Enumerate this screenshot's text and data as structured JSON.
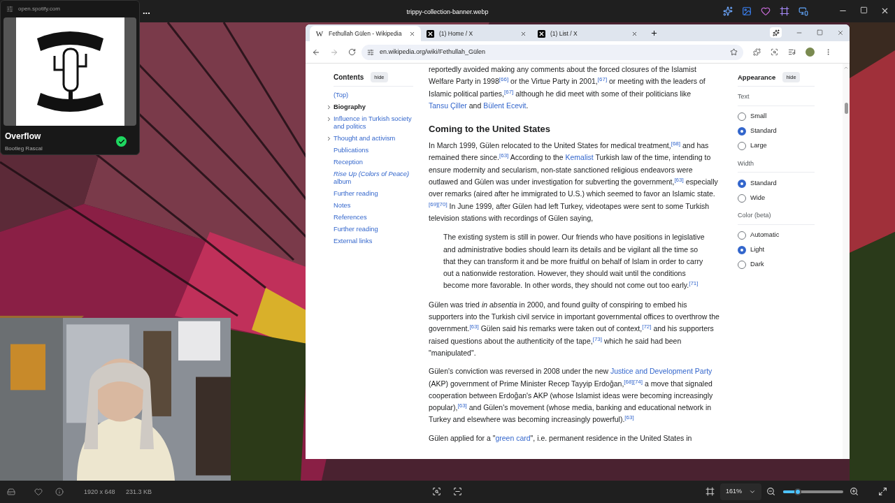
{
  "viewer": {
    "title": "trippy-collection-banner.webp",
    "more": "...",
    "dimensions": "1920 x 648",
    "file_size": "231.3 KB",
    "zoom": "161%",
    "zoom_slider": {
      "level": 0.24
    }
  },
  "mini_player": {
    "site": "open.spotify.com",
    "track": "Overflow",
    "artist": "Bootleg Rascal",
    "saved": true
  },
  "browser": {
    "tabs": [
      {
        "title": "Fethullah Gülen - Wikipedia",
        "favicon": "W",
        "kind": "wiki",
        "selected": true
      },
      {
        "title": "(1) Home / X",
        "kind": "x",
        "selected": false
      },
      {
        "title": "(1) List / X",
        "kind": "x",
        "selected": false
      }
    ],
    "url": "en.wikipedia.org/wiki/Fethullah_Gülen"
  },
  "toc": {
    "title": "Contents",
    "hide": "hide",
    "items": [
      {
        "label": "(Top)",
        "expandable": false,
        "current": false
      },
      {
        "label": "Biography",
        "expandable": true,
        "current": true
      },
      {
        "label": "Influence in Turkish society and politics",
        "expandable": true,
        "current": false
      },
      {
        "label": "Thought and activism",
        "expandable": true,
        "current": false
      },
      {
        "label": "Publications",
        "expandable": false,
        "current": false
      },
      {
        "label": "Reception",
        "expandable": false,
        "current": false
      },
      {
        "label": "*Rise Up (Colors of Peace)* album",
        "expandable": false,
        "current": false
      },
      {
        "label": "Further reading",
        "expandable": false,
        "current": false
      },
      {
        "label": "Notes",
        "expandable": false,
        "current": false
      },
      {
        "label": "References",
        "expandable": false,
        "current": false
      },
      {
        "label": "Further reading",
        "expandable": false,
        "current": false
      },
      {
        "label": "External links",
        "expandable": false,
        "current": false
      }
    ]
  },
  "article": {
    "blocks": [
      {
        "kind": "paragraph",
        "parts": [
          {
            "kind": "text",
            "text": "reportedly avoided making any comments about the forced closures of the Islamist Welfare Party in 1998"
          },
          {
            "kind": "ref",
            "text": "[66]"
          },
          {
            "kind": "text",
            "text": " or the Virtue Party in 2001,"
          },
          {
            "kind": "ref",
            "text": "[67]"
          },
          {
            "kind": "text",
            "text": " or meeting with the leaders of Islamic political parties,"
          },
          {
            "kind": "ref",
            "text": "[67]"
          },
          {
            "kind": "text",
            "text": " although he did meet with some of their politicians like "
          },
          {
            "kind": "link",
            "text": "Tansu Çiller"
          },
          {
            "kind": "text",
            "text": " and "
          },
          {
            "kind": "link",
            "text": "Bülent Ecevit"
          },
          {
            "kind": "text",
            "text": "."
          }
        ]
      },
      {
        "kind": "heading",
        "text": "Coming to the United States"
      },
      {
        "kind": "paragraph",
        "parts": [
          {
            "kind": "text",
            "text": "In March 1999, Gülen relocated to the United States for medical treatment,"
          },
          {
            "kind": "ref",
            "text": "[68]"
          },
          {
            "kind": "text",
            "text": " and has remained there since."
          },
          {
            "kind": "ref",
            "text": "[63]"
          },
          {
            "kind": "text",
            "text": " According to the "
          },
          {
            "kind": "link",
            "text": "Kemalist"
          },
          {
            "kind": "text",
            "text": " Turkish law of the time, intending to ensure modernity and secularism, non-state sanctioned religious endeavors were outlawed and Gülen was under investigation for subverting the government,"
          },
          {
            "kind": "ref",
            "text": "[63]"
          },
          {
            "kind": "text",
            "text": " especially over remarks (aired after he immigrated to U.S.) which seemed to favor an Islamic state."
          },
          {
            "kind": "ref",
            "text": "[69][70]"
          },
          {
            "kind": "text",
            "text": " In June 1999, after Gülen had left Turkey, videotapes were sent to some Turkish television stations with recordings of Gülen saying,"
          }
        ]
      },
      {
        "kind": "quote",
        "parts": [
          {
            "kind": "text",
            "text": "The existing system is still in power. Our friends who have positions in legislative and administrative bodies should learn its details and be vigilant all the time so that they can transform it and be more fruitful on behalf of Islam in order to carry out a nationwide restoration. However, they should wait until the conditions become more favorable. In other words, they should not come out too early."
          },
          {
            "kind": "ref",
            "text": "[71]"
          }
        ]
      },
      {
        "kind": "paragraph",
        "parts": [
          {
            "kind": "text",
            "text": "Gülen was tried "
          },
          {
            "kind": "italic",
            "text": "in absentia"
          },
          {
            "kind": "text",
            "text": " in 2000, and found guilty of conspiring to embed his supporters into the Turkish civil service in important governmental offices to overthrow the government."
          },
          {
            "kind": "ref",
            "text": "[63]"
          },
          {
            "kind": "text",
            "text": " Gülen said his remarks were taken out of context,"
          },
          {
            "kind": "ref",
            "text": "[72]"
          },
          {
            "kind": "text",
            "text": " and his supporters raised questions about the authenticity of the tape,"
          },
          {
            "kind": "ref",
            "text": "[73]"
          },
          {
            "kind": "text",
            "text": " which he said had been \"manipulated\"."
          }
        ]
      },
      {
        "kind": "paragraph",
        "parts": [
          {
            "kind": "text",
            "text": "Gülen's conviction was reversed in 2008 under the new "
          },
          {
            "kind": "link",
            "text": "Justice and Development Party"
          },
          {
            "kind": "text",
            "text": " (AKP) government of Prime Minister Recep Tayyip Erdoğan,"
          },
          {
            "kind": "ref",
            "text": "[68][74]"
          },
          {
            "kind": "text",
            "text": " a move that signaled cooperation between Erdoğan's AKP (whose Islamist ideas were becoming increasingly popular),"
          },
          {
            "kind": "ref",
            "text": "[63]"
          },
          {
            "kind": "text",
            "text": " and Gülen's movement (whose media, banking and educational network in Turkey and elsewhere was becoming increasingly powerful)."
          },
          {
            "kind": "ref",
            "text": "[63]"
          }
        ]
      },
      {
        "kind": "paragraph",
        "parts": [
          {
            "kind": "text",
            "text": "Gülen applied for a \""
          },
          {
            "kind": "link",
            "text": "green card"
          },
          {
            "kind": "text",
            "text": "\", i.e. permanent residence in the United States in"
          }
        ]
      }
    ]
  },
  "appearance": {
    "title": "Appearance",
    "hide": "hide",
    "groups": [
      {
        "label": "Text",
        "options": [
          {
            "label": "Small",
            "selected": false
          },
          {
            "label": "Standard",
            "selected": true
          },
          {
            "label": "Large",
            "selected": false
          }
        ]
      },
      {
        "label": "Width",
        "options": [
          {
            "label": "Standard",
            "selected": true
          },
          {
            "label": "Wide",
            "selected": false
          }
        ]
      },
      {
        "label": "Color (beta)",
        "options": [
          {
            "label": "Automatic",
            "selected": false
          },
          {
            "label": "Light",
            "selected": true
          },
          {
            "label": "Dark",
            "selected": false
          }
        ]
      }
    ]
  }
}
